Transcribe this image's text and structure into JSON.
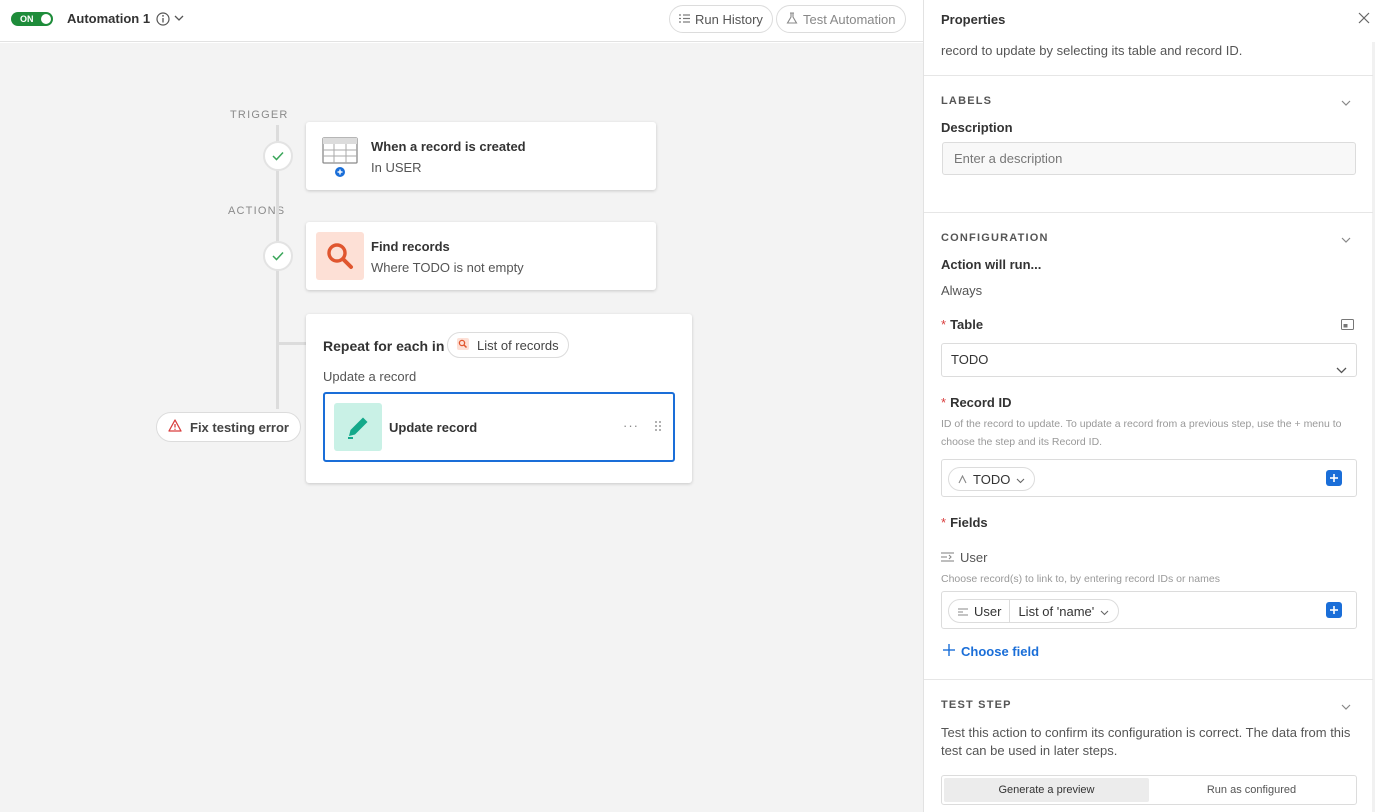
{
  "header": {
    "toggle_label": "ON",
    "automation_name": "Automation 1",
    "run_history": "Run History",
    "test_automation": "Test Automation"
  },
  "flow": {
    "trigger_label": "TRIGGER",
    "actions_label": "ACTIONS",
    "trigger_card": {
      "title": "When a record is created",
      "subtitle": "In USER"
    },
    "find_card": {
      "title": "Find records",
      "subtitle": "Where TODO is not empty"
    },
    "repeat": {
      "title": "Repeat for each in",
      "list_chip": "List of records",
      "sub_label": "Update a record",
      "update_card_title": "Update record",
      "more_label": "···"
    },
    "error_pill": "Fix testing error"
  },
  "panel": {
    "title": "Properties",
    "desc_tail": "record to update by selecting its table and record ID.",
    "labels_section": "LABELS",
    "description_label": "Description",
    "description_placeholder": "Enter a description",
    "config_section": "CONFIGURATION",
    "action_will_run": "Action will run...",
    "always": "Always",
    "table_label": "Table",
    "table_value": "TODO",
    "record_id_label": "Record ID",
    "record_id_help": "ID of the record to update. To update a record from a previous step, use the + menu to choose the step and its Record ID.",
    "record_id_token": "TODO",
    "fields_label": "Fields",
    "user_field": "User",
    "user_help": "Choose record(s) to link to, by entering record IDs or names",
    "user_token_field": "User",
    "user_token_value": "List of 'name'",
    "choose_field": "Choose field",
    "test_section": "TEST STEP",
    "test_desc": "Test this action to confirm its configuration is correct. The data from this test can be used in later steps.",
    "tab_preview": "Generate a preview",
    "tab_run": "Run as configured",
    "required_mark": "*"
  },
  "colors": {
    "accent": "#1a6ed8",
    "toggle_on": "#1e8c3a",
    "find_icon_bg": "#fde0d6",
    "find_icon_fg": "#e0562f",
    "update_icon_bg": "#c9f1e6",
    "update_icon_fg": "#14a98a",
    "error_red": "#d93d3d"
  }
}
